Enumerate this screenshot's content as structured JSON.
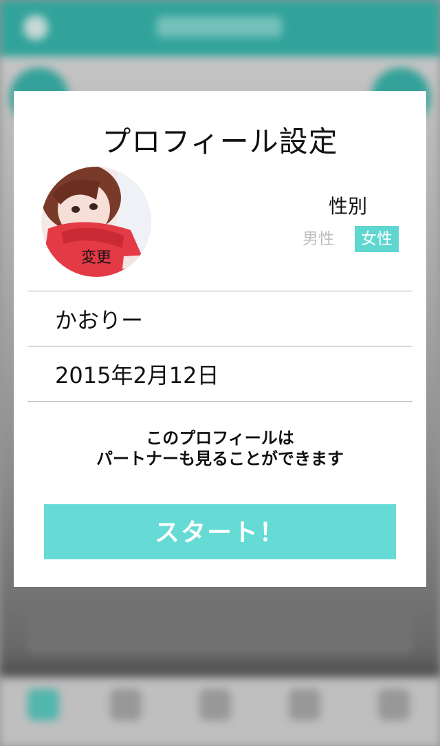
{
  "modal": {
    "title": "プロフィール設定",
    "avatar_change_label": "変更",
    "gender": {
      "label": "性別",
      "options": [
        "男性",
        "女性"
      ],
      "selected": "女性"
    },
    "name_value": "かおりー",
    "date_value": "2015年2月12日",
    "notice_line1": "このプロフィールは",
    "notice_line2": "パートナーも見ることができます",
    "start_label": "スタート！"
  },
  "colors": {
    "header": "#14aba0",
    "accent": "#66dbd5",
    "selected_gender": "#5fd6cf"
  }
}
